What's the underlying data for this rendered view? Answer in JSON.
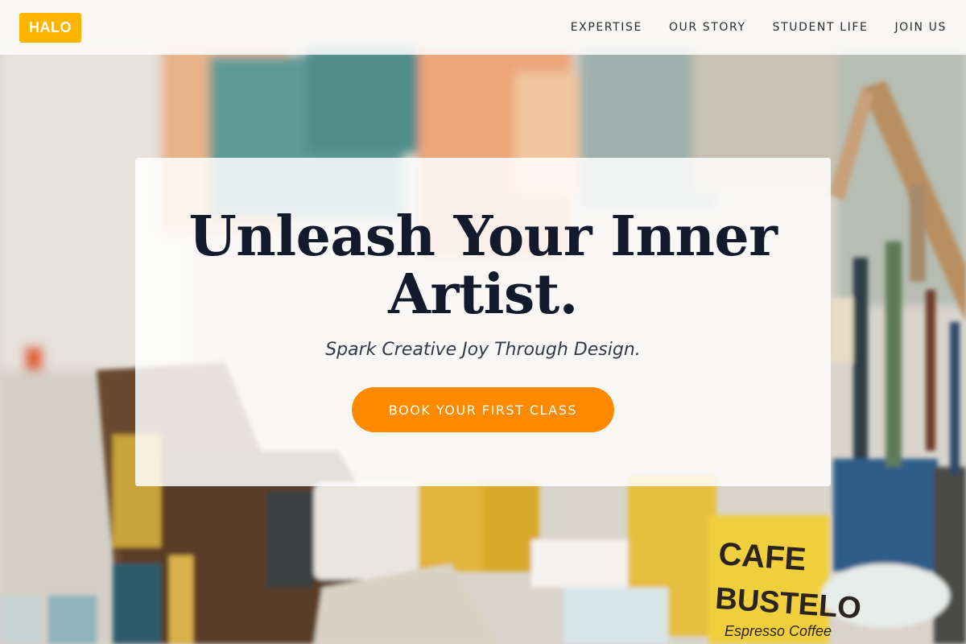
{
  "brand": {
    "logo": "HALO",
    "accent": "#ffb400"
  },
  "nav": {
    "items": [
      {
        "label": "EXPERTISE"
      },
      {
        "label": "OUR STORY"
      },
      {
        "label": "STUDENT LIFE"
      },
      {
        "label": "JOIN US"
      }
    ]
  },
  "hero": {
    "title_line1": "Unleash Your Inner",
    "title_line2": "Artist.",
    "subtitle": "Spark Creative Joy Through Design.",
    "cta_label": "BOOK YOUR FIRST CLASS",
    "cta_color": "#ff8a00"
  },
  "background": {
    "can_label_top": "CAFE",
    "can_label_bottom": "BUSTELO",
    "can_label_small": "Espresso Coffee"
  }
}
